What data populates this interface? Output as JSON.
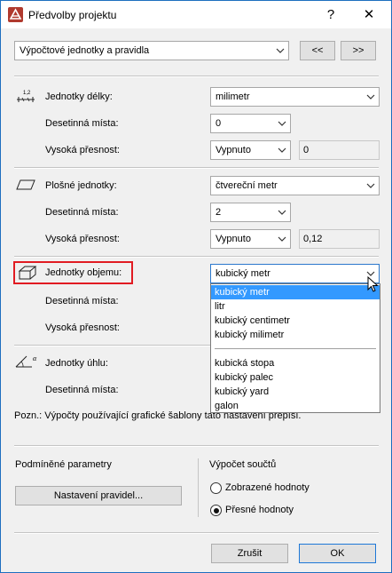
{
  "window": {
    "title": "Předvolby projektu",
    "help": "?",
    "close": "✕"
  },
  "nav": {
    "section_select": "Výpočtové jednotky a pravidla",
    "prev_label": "<<",
    "next_label": ">>"
  },
  "length": {
    "label": "Jednotky délky:",
    "unit": "milimetr",
    "decimals_label": "Desetinná místa:",
    "decimals": "0",
    "precision_label": "Vysoká přesnost:",
    "precision": "Vypnuto",
    "precision_value": "0"
  },
  "area": {
    "label": "Plošné jednotky:",
    "unit": "čtvereční metr",
    "decimals_label": "Desetinná místa:",
    "decimals": "2",
    "precision_label": "Vysoká přesnost:",
    "precision": "Vypnuto",
    "precision_value": "0,12"
  },
  "volume": {
    "label": "Jednotky objemu:",
    "unit": "kubický metr",
    "decimals_label": "Desetinná místa:",
    "precision_label": "Vysoká přesnost:",
    "options_group1": [
      "kubický metr",
      "litr",
      "kubický centimetr",
      "kubický milimetr"
    ],
    "options_group2": [
      "kubická stopa",
      "kubický palec",
      "kubický yard",
      "galon"
    ]
  },
  "angle": {
    "label": "Jednotky úhlu:",
    "decimals_label": "Desetinná místa:"
  },
  "note": "Pozn.: Výpočty používající grafické šablony tato nastavení přepíší.",
  "conditional": {
    "heading": "Podmíněné parametry",
    "button": "Nastavení pravidel..."
  },
  "totals": {
    "heading": "Výpočet součtů",
    "option_displayed": "Zobrazené hodnoty",
    "option_exact": "Přesné hodnoty",
    "selected": "option_exact"
  },
  "footer": {
    "cancel": "Zrušit",
    "ok": "OK"
  },
  "colors": {
    "accent": "#3399ff",
    "highlight": "#e11b22",
    "window_border": "#1e6fbf"
  }
}
